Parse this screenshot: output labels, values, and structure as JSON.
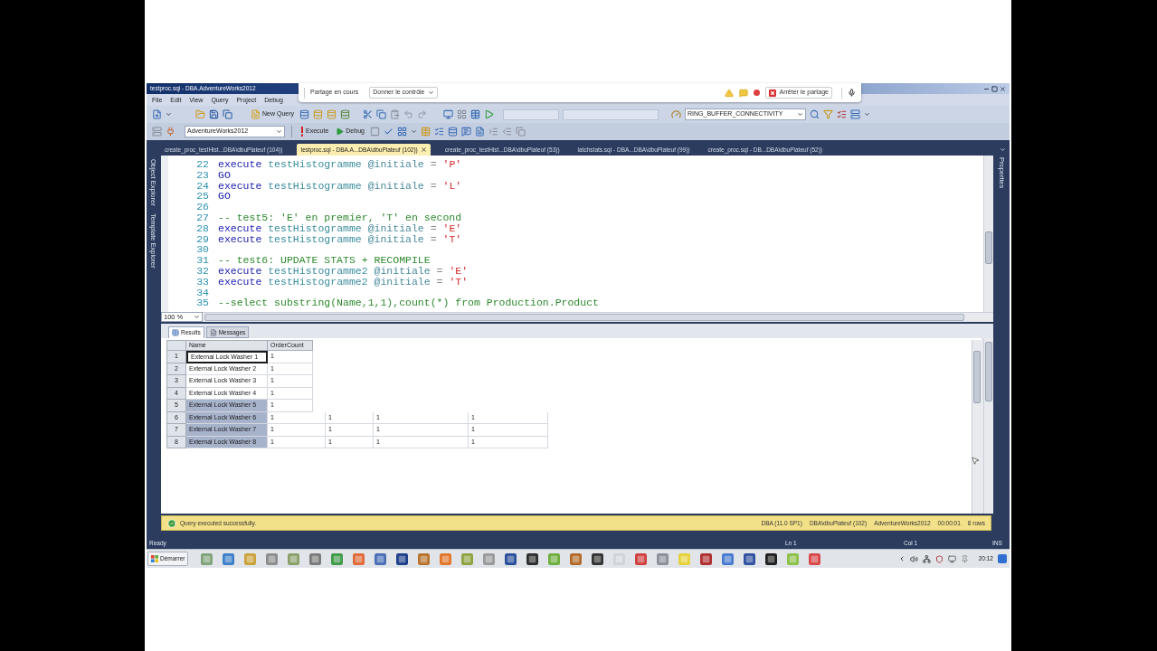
{
  "window": {
    "title": "testproc.sql - DBA.AdventureWorks2012"
  },
  "sharing_bar": {
    "status": "Partage en cours",
    "control_button": "Donner le contrôle",
    "stop_button": "Arrêter le partage"
  },
  "menu": [
    "File",
    "Edit",
    "View",
    "Query",
    "Project",
    "Debug"
  ],
  "toolbar": {
    "new_query": "New Query",
    "session_combo": "RING_BUFFER_CONNECTIVITY",
    "database_combo": "AdventureWorks2012",
    "execute": "Execute",
    "debug": "Debug"
  },
  "document_tabs": [
    {
      "label": "create_proc_testHist...DBA\\dbuPlateuf (104))",
      "selected": false
    },
    {
      "label": "testproc.sql - DBA.A...DBA\\dbuPlateuf (102))",
      "selected": true
    },
    {
      "label": "create_proc_testHist...DBA\\dbuPlateuf (53))",
      "selected": false
    },
    {
      "label": "latchstats.sql - DBA...DBA\\dbuPlateuf (99))",
      "selected": false
    },
    {
      "label": "create_proc.sql - DB...DBA\\dbuPlateuf (52))",
      "selected": false
    }
  ],
  "side_panels": {
    "left": [
      "Object Explorer",
      "Template Explorer"
    ],
    "right": [
      "Properties"
    ]
  },
  "editor": {
    "zoom": "100 %",
    "lines": [
      {
        "number": "22",
        "tokens": [
          {
            "kind": "keyword",
            "text": "execute"
          },
          {
            "kind": "proc",
            "text": "testHistogramme"
          },
          {
            "kind": "variable",
            "text": "@initiale"
          },
          {
            "kind": "operator",
            "text": "="
          },
          {
            "kind": "string",
            "text": "'P'"
          }
        ]
      },
      {
        "number": "23",
        "tokens": [
          {
            "kind": "keyword",
            "text": "GO"
          }
        ]
      },
      {
        "number": "24",
        "tokens": [
          {
            "kind": "keyword",
            "text": "execute"
          },
          {
            "kind": "proc",
            "text": "testHistogramme"
          },
          {
            "kind": "variable",
            "text": "@initiale"
          },
          {
            "kind": "operator",
            "text": "="
          },
          {
            "kind": "string",
            "text": "'L'"
          }
        ]
      },
      {
        "number": "25",
        "tokens": [
          {
            "kind": "keyword",
            "text": "GO"
          }
        ]
      },
      {
        "number": "26"
      },
      {
        "number": "27",
        "tokens": [
          {
            "kind": "comment",
            "text": "-- test5: 'E' en premier, 'T' en second"
          }
        ]
      },
      {
        "number": "28",
        "tokens": [
          {
            "kind": "keyword",
            "text": "execute"
          },
          {
            "kind": "proc",
            "text": "testHistogramme"
          },
          {
            "kind": "variable",
            "text": "@initiale"
          },
          {
            "kind": "operator",
            "text": "="
          },
          {
            "kind": "string",
            "text": "'E'"
          }
        ]
      },
      {
        "number": "29",
        "tokens": [
          {
            "kind": "keyword",
            "text": "execute"
          },
          {
            "kind": "proc",
            "text": "testHistogramme"
          },
          {
            "kind": "variable",
            "text": "@initiale"
          },
          {
            "kind": "operator",
            "text": "="
          },
          {
            "kind": "string",
            "text": "'T'"
          }
        ]
      },
      {
        "number": "30"
      },
      {
        "number": "31",
        "tokens": [
          {
            "kind": "comment",
            "text": "-- test6: UPDATE STATS + RECOMPILE"
          }
        ]
      },
      {
        "number": "32",
        "tokens": [
          {
            "kind": "keyword",
            "text": "execute"
          },
          {
            "kind": "proc",
            "text": "testHistogramme2"
          },
          {
            "kind": "variable",
            "text": "@initiale"
          },
          {
            "kind": "operator",
            "text": "="
          },
          {
            "kind": "string",
            "text": "'E'"
          }
        ]
      },
      {
        "number": "33",
        "tokens": [
          {
            "kind": "keyword",
            "text": "execute"
          },
          {
            "kind": "proc",
            "text": "testHistogramme2"
          },
          {
            "kind": "variable",
            "text": "@initiale"
          },
          {
            "kind": "operator",
            "text": "="
          },
          {
            "kind": "string",
            "text": "'T'"
          }
        ]
      },
      {
        "number": "34"
      },
      {
        "number": "35",
        "tokens": [
          {
            "kind": "comment",
            "text": "--select substring(Name,1,1),count(*) from Production.Product"
          }
        ]
      }
    ]
  },
  "results": {
    "tabs": [
      {
        "label": "Results",
        "selected": true
      },
      {
        "label": "Messages",
        "selected": false
      }
    ],
    "columns": [
      "Name",
      "OrderCount"
    ],
    "rows": [
      {
        "number": "1",
        "name": "External Lock Washer 1",
        "order_count": "1",
        "selected": false,
        "focused": true
      },
      {
        "number": "2",
        "name": "External Lock Washer 2",
        "order_count": "1",
        "selected": false,
        "focused": false
      },
      {
        "number": "3",
        "name": "External Lock Washer 3",
        "order_count": "1",
        "selected": false,
        "focused": false
      },
      {
        "number": "4",
        "name": "External Lock Washer 4",
        "order_count": "1",
        "selected": false,
        "focused": false
      },
      {
        "number": "5",
        "name": "External Lock Washer 5",
        "order_count": "1",
        "selected": true,
        "focused": false
      },
      {
        "number": "6",
        "name": "External Lock Washer 6",
        "order_count": "1",
        "selected": true,
        "focused": false,
        "extra_cells": [
          "1",
          "1",
          "1"
        ]
      },
      {
        "number": "7",
        "name": "External Lock Washer 7",
        "order_count": "1",
        "selected": true,
        "focused": false,
        "extra_cells": [
          "1",
          "1",
          "1"
        ]
      },
      {
        "number": "8",
        "name": "External Lock Washer 8",
        "order_count": "1",
        "selected": true,
        "focused": false,
        "extra_cells": [
          "1",
          "1",
          "1"
        ]
      }
    ]
  },
  "query_status": {
    "message": "Query executed successfully.",
    "fields": [
      "DBA (11.0 SP1)",
      "DBA\\dbuPlateuf (102)",
      "AdventureWorks2012",
      "00:00:01",
      "8 rows"
    ]
  },
  "status_bar": {
    "state": "Ready",
    "line": "Ln 1",
    "column": "Col 1",
    "mode": "INS"
  },
  "taskbar": {
    "start": "Démarrer",
    "clock": "20:12"
  }
}
